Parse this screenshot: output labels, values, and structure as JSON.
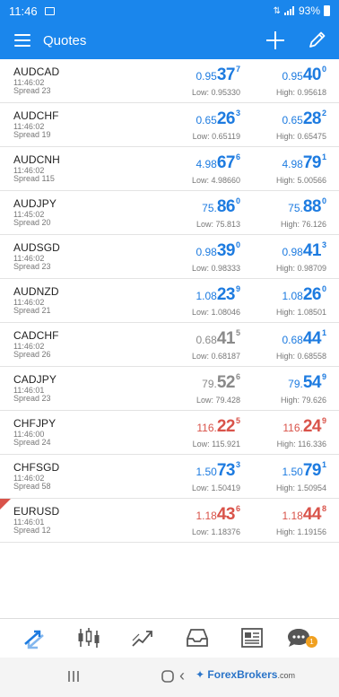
{
  "status": {
    "time": "11:46",
    "battery": "93%"
  },
  "appbar": {
    "title": "Quotes"
  },
  "quotes": [
    {
      "symbol": "AUDCAD",
      "time": "11:46:02",
      "spread": "Spread 23",
      "bid_pre": "0.95",
      "bid_big": "37",
      "bid_sup": "7",
      "ask_pre": "0.95",
      "ask_big": "40",
      "ask_sup": "0",
      "low": "Low: 0.95330",
      "high": "High: 0.95618",
      "bid_color": "blue",
      "ask_color": "blue"
    },
    {
      "symbol": "AUDCHF",
      "time": "11:46:02",
      "spread": "Spread 19",
      "bid_pre": "0.65",
      "bid_big": "26",
      "bid_sup": "3",
      "ask_pre": "0.65",
      "ask_big": "28",
      "ask_sup": "2",
      "low": "Low: 0.65119",
      "high": "High: 0.65475",
      "bid_color": "blue",
      "ask_color": "blue"
    },
    {
      "symbol": "AUDCNH",
      "time": "11:46:02",
      "spread": "Spread 115",
      "bid_pre": "4.98",
      "bid_big": "67",
      "bid_sup": "6",
      "ask_pre": "4.98",
      "ask_big": "79",
      "ask_sup": "1",
      "low": "Low: 4.98660",
      "high": "High: 5.00566",
      "bid_color": "blue",
      "ask_color": "blue"
    },
    {
      "symbol": "AUDJPY",
      "time": "11:45:02",
      "spread": "Spread 20",
      "bid_pre": "75.",
      "bid_big": "86",
      "bid_sup": "0",
      "ask_pre": "75.",
      "ask_big": "88",
      "ask_sup": "0",
      "low": "Low: 75.813",
      "high": "High: 76.126",
      "bid_color": "blue",
      "ask_color": "blue"
    },
    {
      "symbol": "AUDSGD",
      "time": "11:46:02",
      "spread": "Spread 23",
      "bid_pre": "0.98",
      "bid_big": "39",
      "bid_sup": "0",
      "ask_pre": "0.98",
      "ask_big": "41",
      "ask_sup": "3",
      "low": "Low: 0.98333",
      "high": "High: 0.98709",
      "bid_color": "blue",
      "ask_color": "blue"
    },
    {
      "symbol": "AUDNZD",
      "time": "11:46:02",
      "spread": "Spread 21",
      "bid_pre": "1.08",
      "bid_big": "23",
      "bid_sup": "9",
      "ask_pre": "1.08",
      "ask_big": "26",
      "ask_sup": "0",
      "low": "Low: 1.08046",
      "high": "High: 1.08501",
      "bid_color": "blue",
      "ask_color": "blue"
    },
    {
      "symbol": "CADCHF",
      "time": "11:46:02",
      "spread": "Spread 26",
      "bid_pre": "0.68",
      "bid_big": "41",
      "bid_sup": "5",
      "ask_pre": "0.68",
      "ask_big": "44",
      "ask_sup": "1",
      "low": "Low: 0.68187",
      "high": "High: 0.68558",
      "bid_color": "gray",
      "ask_color": "blue"
    },
    {
      "symbol": "CADJPY",
      "time": "11:46:01",
      "spread": "Spread 23",
      "bid_pre": "79.",
      "bid_big": "52",
      "bid_sup": "6",
      "ask_pre": "79.",
      "ask_big": "54",
      "ask_sup": "9",
      "low": "Low: 79.428",
      "high": "High: 79.626",
      "bid_color": "gray",
      "ask_color": "blue"
    },
    {
      "symbol": "CHFJPY",
      "time": "11:46:00",
      "spread": "Spread 24",
      "bid_pre": "116.",
      "bid_big": "22",
      "bid_sup": "5",
      "ask_pre": "116.",
      "ask_big": "24",
      "ask_sup": "9",
      "low": "Low: 115.921",
      "high": "High: 116.336",
      "bid_color": "red",
      "ask_color": "red"
    },
    {
      "symbol": "CHFSGD",
      "time": "11:46:02",
      "spread": "Spread 58",
      "bid_pre": "1.50",
      "bid_big": "73",
      "bid_sup": "3",
      "ask_pre": "1.50",
      "ask_big": "79",
      "ask_sup": "1",
      "low": "Low: 1.50419",
      "high": "High: 1.50954",
      "bid_color": "blue",
      "ask_color": "blue"
    },
    {
      "symbol": "EURUSD",
      "time": "11:46:01",
      "spread": "Spread 12",
      "bid_pre": "1.18",
      "bid_big": "43",
      "bid_sup": "6",
      "ask_pre": "1.18",
      "ask_big": "44",
      "ask_sup": "8",
      "low": "Low: 1.18376",
      "high": "High: 1.19156",
      "bid_color": "red",
      "ask_color": "red"
    }
  ],
  "bottom_nav": {
    "items": [
      "quotes-icon",
      "chart-icon",
      "trade-icon",
      "history-icon",
      "news-icon",
      "messages-icon"
    ],
    "badge": "1"
  },
  "watermark": {
    "brand_a": "Forex",
    "brand_b": "Brokers",
    "suffix": ".com"
  },
  "colors": {
    "accent": "#1a86ec",
    "up": "#1d7be0",
    "down": "#d9534a",
    "neutral": "#8a8a8a"
  }
}
